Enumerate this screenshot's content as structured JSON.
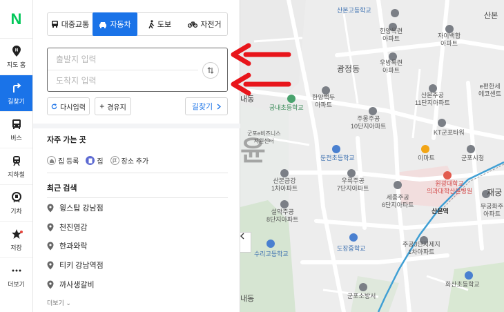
{
  "rail": {
    "logo": "N",
    "items": [
      {
        "label": "지도 홈",
        "icon": "map-pin-n-icon"
      },
      {
        "label": "길찾기",
        "icon": "direction-arrow-icon"
      },
      {
        "label": "버스",
        "icon": "bus-icon"
      },
      {
        "label": "지하철",
        "icon": "subway-icon"
      },
      {
        "label": "기차",
        "icon": "train-icon"
      },
      {
        "label": "저장",
        "icon": "star-icon"
      },
      {
        "label": "더보기",
        "icon": "more-dots-icon"
      }
    ]
  },
  "modes": [
    {
      "label": "대중교통",
      "icon": "bus-icon"
    },
    {
      "label": "자동차",
      "icon": "car-icon"
    },
    {
      "label": "도보",
      "icon": "walk-icon"
    },
    {
      "label": "자전거",
      "icon": "bicycle-icon"
    }
  ],
  "route": {
    "origin_placeholder": "출발지 입력",
    "destination_placeholder": "도착지 입력"
  },
  "buttons": {
    "reset": "다시입력",
    "waypoint": "경유지",
    "find": "길찾기"
  },
  "favorites": {
    "title": "자주 가는 곳",
    "items": [
      "집 등록",
      "집",
      "장소 추가"
    ]
  },
  "recent": {
    "title": "최근 검색",
    "items": [
      "윙스탑 강남점",
      "천진영감",
      "한과와락",
      "티키 강남역점",
      "까사생갈비"
    ],
    "more": "더보기"
  },
  "map": {
    "watermark": "윤",
    "labels": [
      "산본고등학교",
      "한양목련\n아파트",
      "자이백합\n아파트",
      "산본",
      "우방목련\n아파트",
      "광정동",
      "한양백두\n아파트",
      "산본주공\n11단지아파트",
      "e편한세\n에코센트",
      "내동",
      "궁내초등학교",
      "주몽주공\n10단지아파트",
      "KT군포타워",
      "군포e비즈니스\n지원센터",
      "둔전초등학교",
      "이마트",
      "군포시청",
      "산본금강\n1차아파트",
      "우륵주공\n7단지아파트",
      "세종주공\n6단지아파트",
      "원광대학교\n의과대학산본병원",
      "재궁",
      "무궁화주\n아파트",
      "설악주공\n8단지아파트",
      "산본역",
      "수리고등학교",
      "도장중학교",
      "주공3단지제지\n1차아파트",
      "군포소방서",
      "화산초등학교",
      "내동"
    ]
  },
  "colors": {
    "accent": "#1a73e8",
    "brand": "#03c75a",
    "arrow": "#e8151b"
  }
}
